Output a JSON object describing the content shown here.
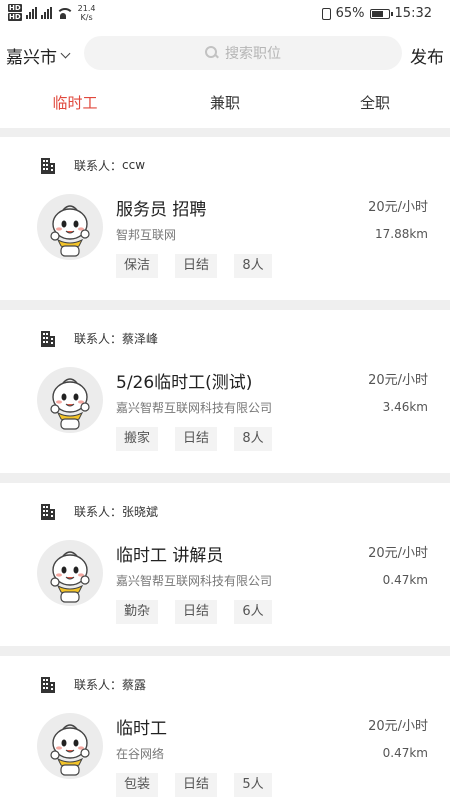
{
  "status_bar": {
    "network_label": "4G",
    "speed_value": "21.4",
    "speed_unit": "K/s",
    "battery": "65%",
    "time": "15:32"
  },
  "header": {
    "city": "嘉兴市",
    "search_placeholder": "搜索职位",
    "publish_label": "发布"
  },
  "tabs": [
    {
      "label": "临时工",
      "active": true
    },
    {
      "label": "兼职",
      "active": false
    },
    {
      "label": "全职",
      "active": false
    }
  ],
  "jobs": [
    {
      "contact_prefix": "联系人：",
      "contact": "ccw",
      "title": "服务员 招聘",
      "company": "智邦互联网",
      "pay": "20元/小时",
      "distance": "17.88km",
      "tags": [
        "保洁",
        "日结",
        "8人"
      ]
    },
    {
      "contact_prefix": "联系人：",
      "contact": "蔡泽峰",
      "title": "5/26临时工(测试)",
      "company": "嘉兴智帮互联网科技有限公司",
      "pay": "20元/小时",
      "distance": "3.46km",
      "tags": [
        "搬家",
        "日结",
        "8人"
      ]
    },
    {
      "contact_prefix": "联系人：",
      "contact": "张晓斌",
      "title": "临时工 讲解员",
      "company": "嘉兴智帮互联网科技有限公司",
      "pay": "20元/小时",
      "distance": "0.47km",
      "tags": [
        "勤杂",
        "日结",
        "6人"
      ]
    },
    {
      "contact_prefix": "联系人：",
      "contact": "蔡露",
      "title": "临时工",
      "company": "在谷网络",
      "pay": "20元/小时",
      "distance": "0.47km",
      "tags": [
        "包装",
        "日结",
        "5人"
      ]
    }
  ],
  "colors": {
    "accent": "#e0483c",
    "background": "#efefef",
    "tag_bg": "#f3f3f3"
  },
  "icons": {
    "building": "building-icon",
    "avatar": "mascot-avatar",
    "search": "search-icon"
  }
}
